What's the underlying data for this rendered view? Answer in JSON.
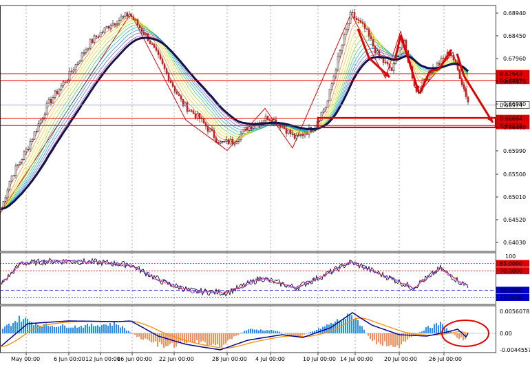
{
  "chart_data": [
    {
      "type": "candlestick",
      "pane": "price",
      "ylim": [
        0.6388,
        0.694
      ],
      "price_ticks": [
        "0.68940",
        "0.68450",
        "0.67960",
        "0.67470",
        "0.66980",
        "0.66490",
        "0.65990",
        "0.65500",
        "0.65010",
        "0.64520",
        "0.64030"
      ],
      "x_labels": [
        "May 00:00",
        "6 Jun 00:00",
        "12 Jun 00:00",
        "16 Jun 00:00",
        "22 Jun 00:00",
        "28 Jun 00:00",
        "4 Jul 00:00",
        "10 Jul 00:00",
        "14 Jul 00:00",
        "20 Jul 00:00",
        "26 Jul 00:00"
      ],
      "approx_close_path": [
        0.6465,
        0.654,
        0.662,
        0.67,
        0.678,
        0.686,
        0.689,
        0.683,
        0.676,
        0.67,
        0.6665,
        0.664,
        0.661,
        0.664,
        0.667,
        0.6648,
        0.662,
        0.666,
        0.678,
        0.689,
        0.686,
        0.679,
        0.6745,
        0.68,
        0.677,
        0.68,
        0.676,
        0.672
      ],
      "horizontal_levels": [
        {
          "value": 0.67643,
          "label": "0.67643",
          "color": "#e00000"
        },
        {
          "value": 0.67497,
          "label": "0.67497",
          "color": "#e00000"
        },
        {
          "value": 0.66974,
          "label": "0.66974",
          "color": "#9ab0d8"
        },
        {
          "value": 0.66684,
          "label": "0.66684",
          "color": "#e00000"
        },
        {
          "value": 0.66532,
          "label": "0.66532",
          "color": "#e00000"
        }
      ],
      "current_price": "0.66974"
    },
    {
      "type": "line",
      "pane": "oscillator",
      "ylim": [
        0,
        100
      ],
      "levels": [
        {
          "value": 100,
          "label": "100"
        },
        {
          "value": 85,
          "label": "85.0000",
          "color": "#e00000"
        },
        {
          "value": 70,
          "label": "70.0000",
          "color": "#e00000"
        },
        {
          "value": 30,
          "label": "30.0000",
          "color": "#0000cc"
        },
        {
          "value": 15,
          "label": "15.0000",
          "color": "#0000cc"
        }
      ]
    },
    {
      "type": "bar",
      "pane": "macd",
      "ticks": [
        "0.0056078",
        "0.00",
        "-0.0044557"
      ],
      "colors": {
        "positive": "#1e90ff",
        "negative": "#ff8c55",
        "signal": "#ff8c00",
        "macd": "#00008b"
      }
    }
  ]
}
